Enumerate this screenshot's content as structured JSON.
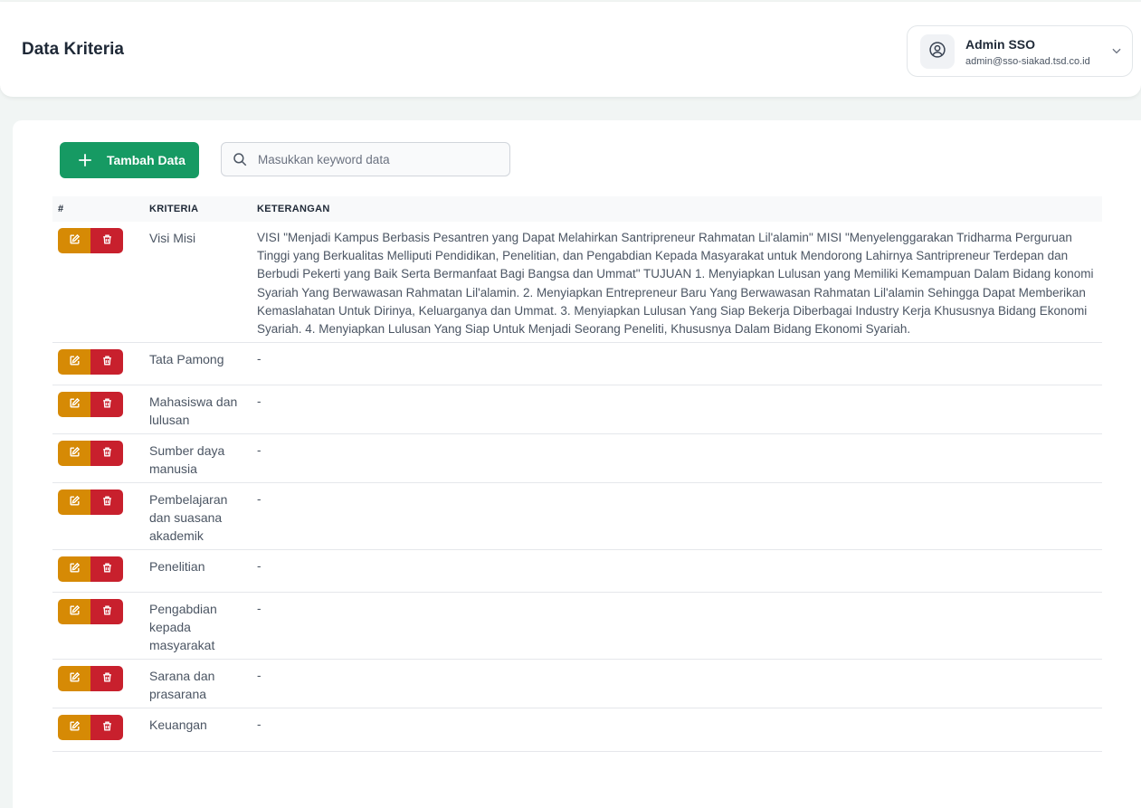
{
  "header": {
    "title": "Data Kriteria",
    "user": {
      "name": "Admin SSO",
      "email": "admin@sso-siakad.tsd.co.id"
    }
  },
  "toolbar": {
    "add_label": "Tambah Data",
    "search_placeholder": "Masukkan keyword data"
  },
  "colors": {
    "primary": "#169a63",
    "edit": "#d68a05",
    "delete": "#c8202d"
  },
  "table": {
    "columns": [
      "#",
      "KRITERIA",
      "KETERANGAN"
    ],
    "rows": [
      {
        "kriteria": "Visi Misi",
        "keterangan": "VISI \"Menjadi Kampus Berbasis Pesantren yang Dapat Melahirkan Santripreneur Rahmatan Lil'alamin\" MISI \"Menyelenggarakan Tridharma Perguruan Tinggi yang Berkualitas Melliputi Pendidikan, Penelitian, dan Pengabdian Kepada Masyarakat untuk Mendorong Lahirnya Santripreneur Terdepan dan Berbudi Pekerti yang Baik Serta Bermanfaat Bagi Bangsa dan Ummat\" TUJUAN 1. Menyiapkan Lulusan yang Memiliki Kemampuan Dalam Bidang konomi Syariah Yang Berwawasan Rahmatan Lil'alamin. 2. Menyiapkan Entrepreneur Baru Yang Berwawasan Rahmatan Lil'alamin Sehingga Dapat Memberikan Kemaslahatan Untuk Dirinya, Keluarganya dan Ummat. 3. Menyiapkan Lulusan Yang Siap Bekerja Diberbagai Industry Kerja Khususnya Bidang Ekonomi Syariah. 4. Menyiapkan Lulusan Yang Siap Untuk Menjadi Seorang Peneliti, Khususnya Dalam Bidang Ekonomi Syariah."
      },
      {
        "kriteria": "Tata Pamong",
        "keterangan": "-"
      },
      {
        "kriteria": "Mahasiswa dan lulusan",
        "keterangan": "-"
      },
      {
        "kriteria": "Sumber daya manusia",
        "keterangan": "-"
      },
      {
        "kriteria": "Pembelajaran dan suasana akademik",
        "keterangan": "-"
      },
      {
        "kriteria": "Penelitian",
        "keterangan": "-"
      },
      {
        "kriteria": "Pengabdian kepada masyarakat",
        "keterangan": "-"
      },
      {
        "kriteria": "Sarana dan prasarana",
        "keterangan": "-"
      },
      {
        "kriteria": "Keuangan",
        "keterangan": "-"
      }
    ]
  }
}
